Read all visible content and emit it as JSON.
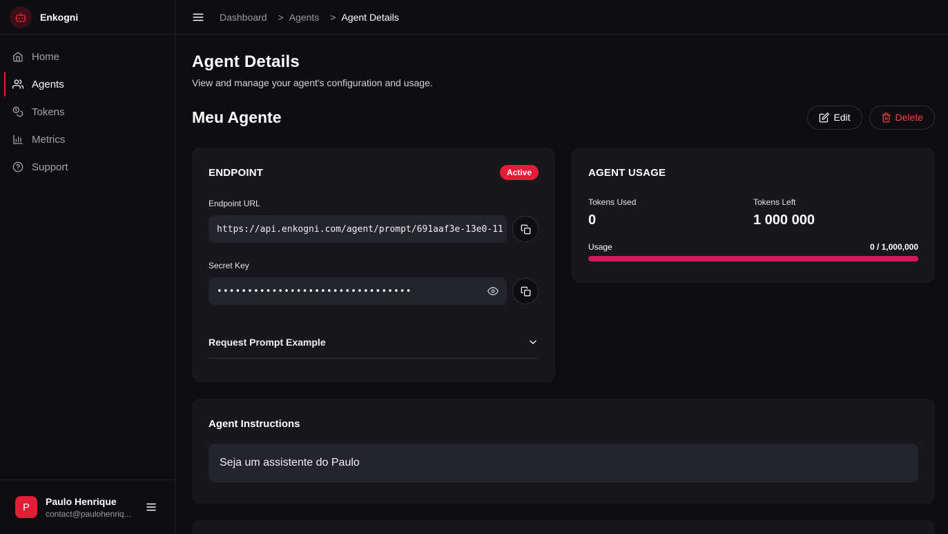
{
  "app": {
    "name": "Enkogni"
  },
  "sidebar": {
    "items": [
      {
        "label": "Home",
        "icon": "home-icon",
        "active": false
      },
      {
        "label": "Agents",
        "icon": "users-icon",
        "active": true
      },
      {
        "label": "Tokens",
        "icon": "coins-icon",
        "active": false
      },
      {
        "label": "Metrics",
        "icon": "bar-chart-icon",
        "active": false
      },
      {
        "label": "Support",
        "icon": "help-circle-icon",
        "active": false
      }
    ],
    "user": {
      "initial": "P",
      "name": "Paulo Henrique",
      "email": "contact@paulohenriq..."
    }
  },
  "breadcrumb": {
    "items": [
      "Dashboard",
      "Agents",
      "Agent Details"
    ],
    "separator": ">"
  },
  "page": {
    "title": "Agent Details",
    "subtitle": "View and manage your agent's configuration and usage.",
    "agent_name": "Meu Agente",
    "edit_label": "Edit",
    "delete_label": "Delete"
  },
  "endpoint": {
    "title": "ENDPOINT",
    "status": "Active",
    "url_label": "Endpoint URL",
    "url_value": "https://api.enkogni.com/agent/prompt/691aaf3e-13e0-11",
    "secret_label": "Secret Key",
    "secret_value": "••••••••••••••••••••••••••••••••",
    "example_label": "Request Prompt Example"
  },
  "usage": {
    "title": "AGENT USAGE",
    "tokens_used_label": "Tokens Used",
    "tokens_used_value": "0",
    "tokens_left_label": "Tokens Left",
    "tokens_left_value": "1 000 000",
    "usage_label": "Usage",
    "usage_count": "0 / 1,000,000",
    "usage_fraction": 0
  },
  "instructions": {
    "title": "Agent Instructions",
    "text": "Seja um assistente do Paulo"
  },
  "colors": {
    "accent": "#e11d38",
    "progress": "#d3175c",
    "danger": "#ef4444",
    "background": "#0e0e12",
    "card": "#17171c"
  }
}
